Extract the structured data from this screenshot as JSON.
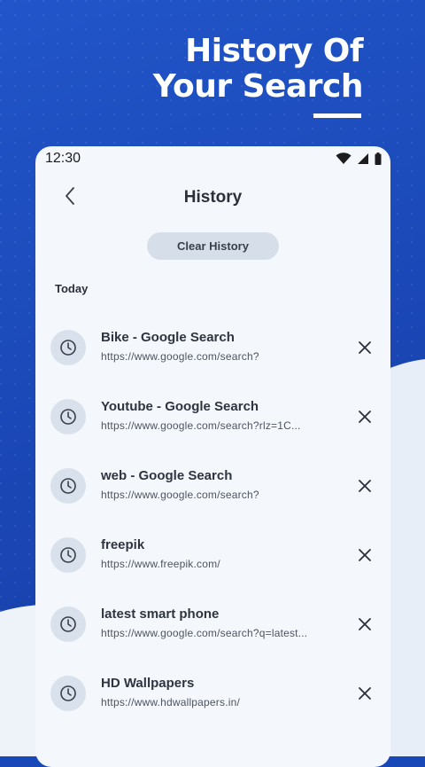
{
  "hero": {
    "line1": "History Of",
    "line2": "Your Search"
  },
  "status": {
    "time": "12:30",
    "icons": [
      "wifi-icon",
      "signal-icon",
      "battery-icon"
    ]
  },
  "appbar": {
    "title": "History",
    "back_icon": "chevron-left-icon"
  },
  "actions": {
    "clear_label": "Clear History"
  },
  "history": {
    "section_label": "Today",
    "items": [
      {
        "title": "Bike - Google Search",
        "url": "https://www.google.com/search?"
      },
      {
        "title": "Youtube - Google Search",
        "url": "https://www.google.com/search?rlz=1C..."
      },
      {
        "title": "web - Google Search",
        "url": "https://www.google.com/search?"
      },
      {
        "title": "freepik",
        "url": "https://www.freepik.com/"
      },
      {
        "title": "latest smart phone",
        "url": "https://www.google.com/search?q=latest..."
      },
      {
        "title": "HD Wallpapers",
        "url": "https://www.hdwallpapers.in/"
      }
    ]
  },
  "colors": {
    "background_blue": "#1a46b4",
    "screen_bg": "#f4f7fb",
    "icon_circle": "#d9e2ec",
    "button_bg": "#d6dfe9",
    "text_dark": "#2e3440"
  }
}
